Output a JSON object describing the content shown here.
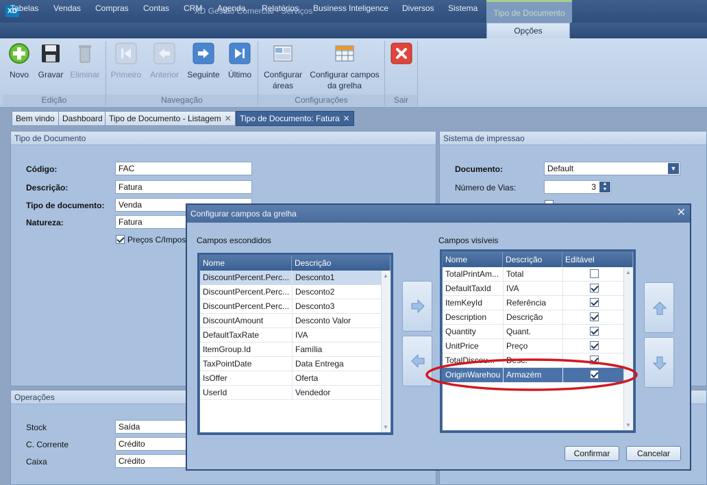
{
  "window": {
    "logo": "XD",
    "title": "XD Gestão Comercial - Serviços",
    "context_tab": "Tipo de Documento"
  },
  "menu": {
    "items": [
      "Tabelas",
      "Vendas",
      "Compras",
      "Contas",
      "CRM",
      "Agenda",
      "Relatórios",
      "Business Inteligence",
      "Diversos",
      "Sistema"
    ],
    "active": "Opções"
  },
  "ribbon": {
    "buttons": {
      "novo": "Novo",
      "gravar": "Gravar",
      "eliminar": "Eliminar",
      "primeiro": "Primeiro",
      "anterior": "Anterior",
      "seguinte": "Seguinte",
      "ultimo": "Último",
      "config_areas_1": "Configurar",
      "config_areas_2": "áreas",
      "config_campos_1": "Configurar campos",
      "config_campos_2": "da grelha"
    },
    "groups": {
      "edicao": "Edição",
      "navegacao": "Navegação",
      "configuracoes": "Configurações",
      "sair": "Sair"
    }
  },
  "tabs": {
    "t1": "Bem vindo",
    "t2": "Dashboard",
    "t3": "Tipo de Documento - Listagem",
    "t4": "Tipo de Documento: Fatura"
  },
  "tipo_documento": {
    "header": "Tipo de Documento",
    "codigo_label": "Código:",
    "codigo": "FAC",
    "descricao_label": "Descrição:",
    "descricao": "Fatura",
    "tipo_label": "Tipo de documento:",
    "tipo": "Venda",
    "natureza_label": "Natureza:",
    "natureza": "Fatura",
    "precos_label": "Preços C/Impos"
  },
  "impressao": {
    "header": "Sistema de impressao",
    "documento_label": "Documento:",
    "documento": "Default",
    "vias_label": "Número de Vias:",
    "vias": "3"
  },
  "operacoes": {
    "header": "Operações",
    "stock_label": "Stock",
    "stock": "Saída",
    "cc_label": "C. Corrente",
    "cc": "Crédito",
    "caixa_label": "Caixa",
    "caixa": "Crédito"
  },
  "dialog": {
    "title": "Configurar campos da grelha",
    "hidden_label": "Campos escondidos",
    "visible_label": "Campos visíveis",
    "col_nome": "Nome",
    "col_descricao": "Descrição",
    "col_editavel": "Editável",
    "hidden_rows": [
      {
        "nome": "DiscountPercent.Perc...",
        "desc": "Desconto1"
      },
      {
        "nome": "DiscountPercent.Perc...",
        "desc": "Desconto2"
      },
      {
        "nome": "DiscountPercent.Perc...",
        "desc": "Desconto3"
      },
      {
        "nome": "DiscountAmount",
        "desc": "Desconto Valor"
      },
      {
        "nome": "DefaultTaxRate",
        "desc": "IVA"
      },
      {
        "nome": "ItemGroup.Id",
        "desc": "Família"
      },
      {
        "nome": "TaxPointDate",
        "desc": "Data Entrega"
      },
      {
        "nome": "IsOffer",
        "desc": "Oferta"
      },
      {
        "nome": "UserId",
        "desc": "Vendedor"
      }
    ],
    "visible_rows": [
      {
        "nome": "TotalPrintAm...",
        "desc": "Total",
        "editavel": false
      },
      {
        "nome": "DefaultTaxId",
        "desc": "IVA",
        "editavel": true
      },
      {
        "nome": "ItemKeyId",
        "desc": "Referência",
        "editavel": true
      },
      {
        "nome": "Description",
        "desc": "Descrição",
        "editavel": true
      },
      {
        "nome": "Quantity",
        "desc": "Quant.",
        "editavel": true
      },
      {
        "nome": "UnitPrice",
        "desc": "Preço",
        "editavel": true
      },
      {
        "nome": "TotalDiscou...",
        "desc": "Desc.",
        "editavel": true
      },
      {
        "nome": "OriginWarehou",
        "desc": "Armazém",
        "editavel": true
      }
    ],
    "confirm": "Confirmar",
    "cancel": "Cancelar"
  },
  "colors": {
    "annotation": "#d0191f",
    "accent": "#3a5f91"
  }
}
